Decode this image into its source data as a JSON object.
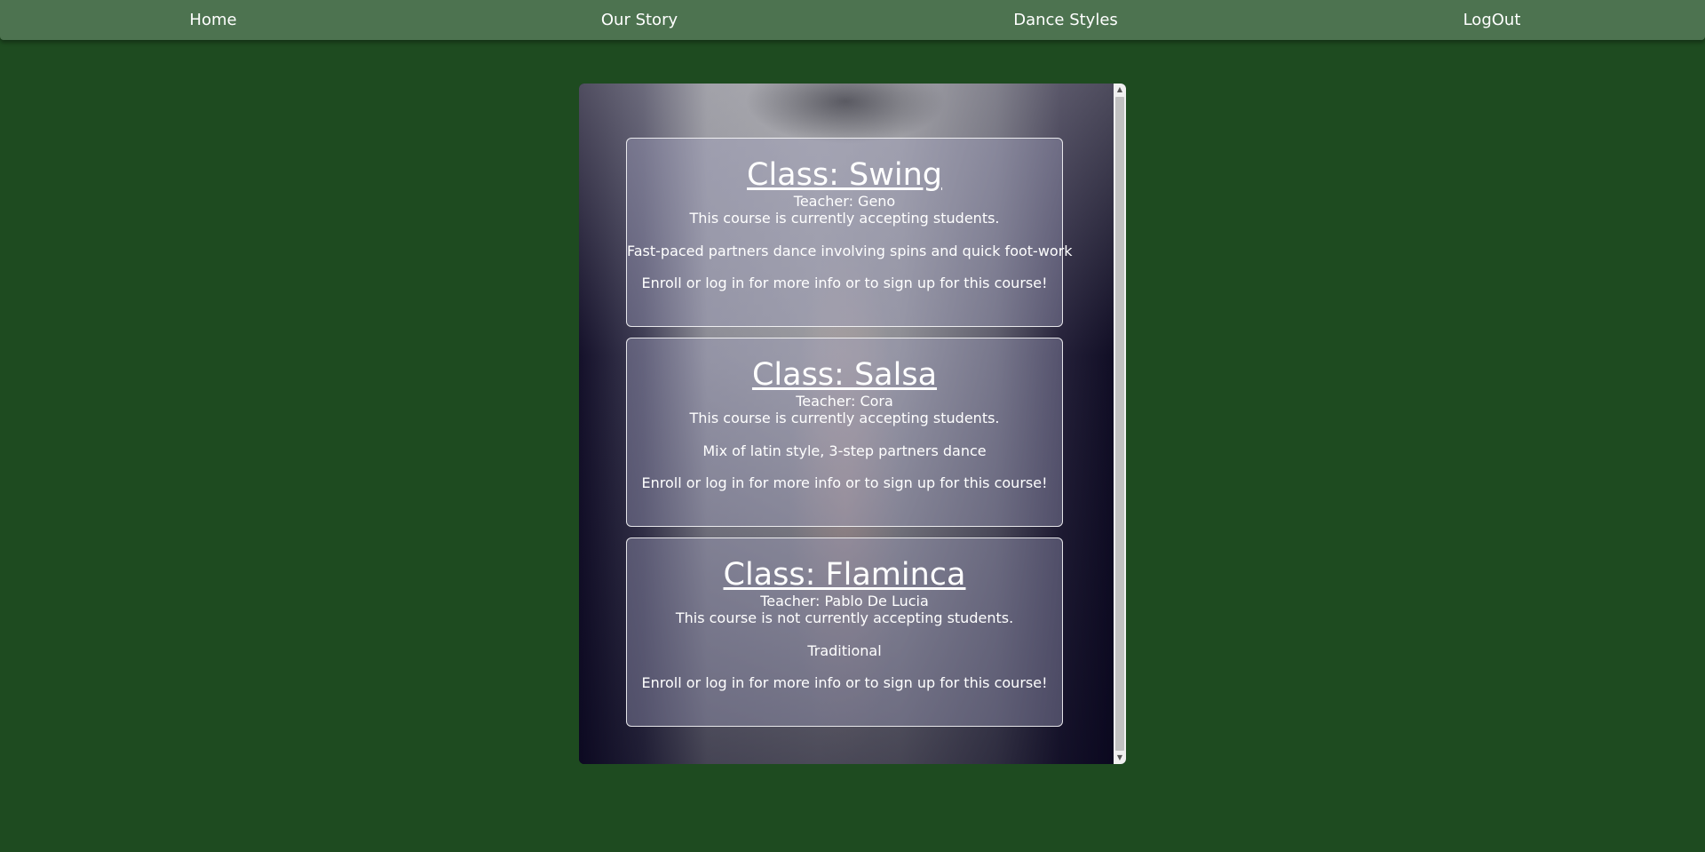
{
  "nav": {
    "items": [
      {
        "label": "Home"
      },
      {
        "label": "Our Story"
      },
      {
        "label": "Dance Styles"
      },
      {
        "label": "LogOut"
      }
    ]
  },
  "classes": [
    {
      "title": "Class: Swing",
      "teacher": "Teacher: Geno",
      "status": "This course is currently accepting students.",
      "description": "Fast-paced partners dance involving spins and quick foot-work",
      "cta": "Enroll or log in for more info or to sign up for this course!"
    },
    {
      "title": "Class: Salsa",
      "teacher": "Teacher: Cora",
      "status": "This course is currently accepting students.",
      "description": "Mix of latin style, 3-step partners dance",
      "cta": "Enroll or log in for more info or to sign up for this course!"
    },
    {
      "title": "Class: Flaminca",
      "teacher": "Teacher: Pablo De Lucia",
      "status": "This course is not currently accepting students.",
      "description": "Traditional",
      "cta": "Enroll or log in for more info or to sign up for this course!"
    }
  ],
  "colors": {
    "page_background": "#1e4b20",
    "navbar_background": "#4d7350",
    "text": "#ffffff"
  },
  "icons": {
    "scroll_up": "triangle-up-icon",
    "scroll_down": "triangle-down-icon"
  }
}
